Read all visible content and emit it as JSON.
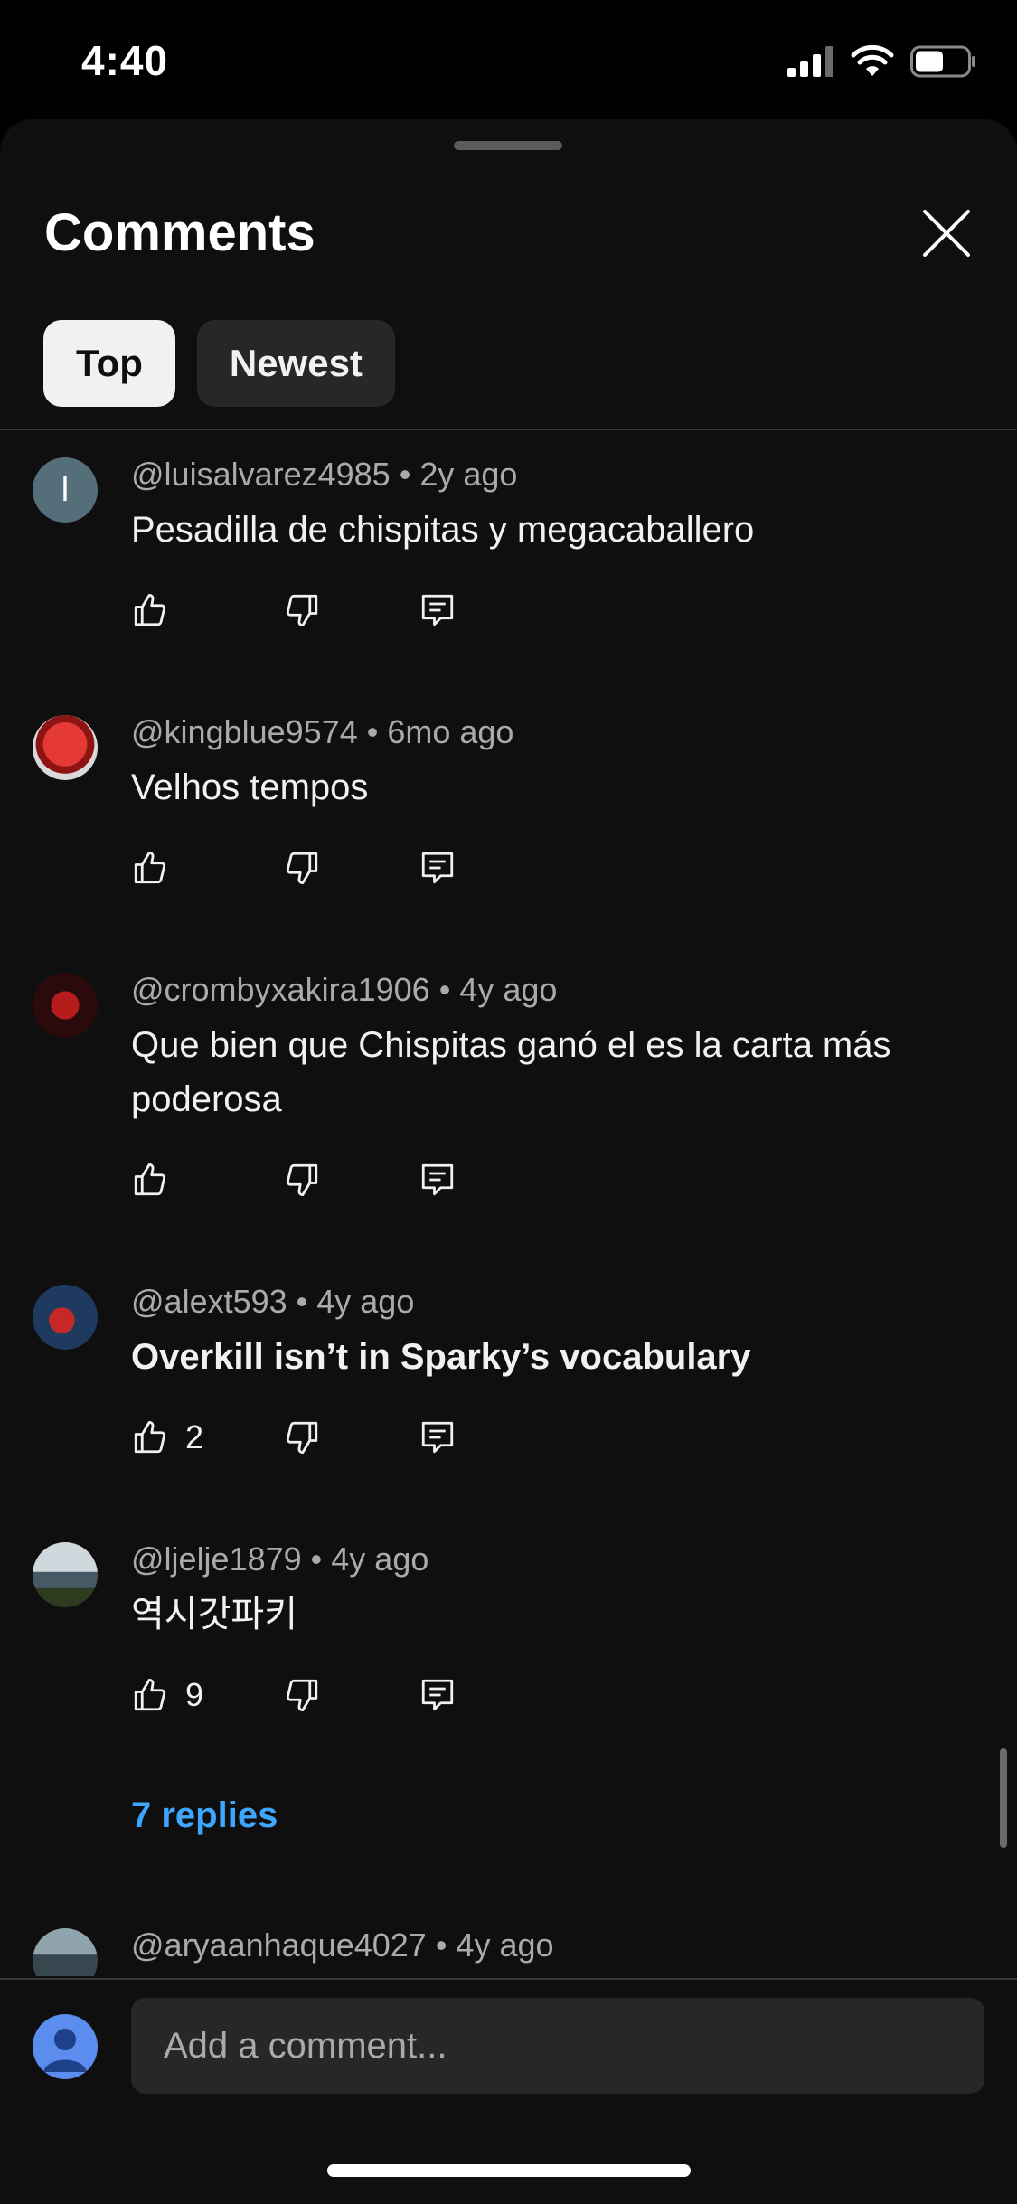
{
  "status": {
    "time": "4:40"
  },
  "sheet": {
    "title": "Comments",
    "tabs": [
      {
        "label": "Top"
      },
      {
        "label": "Newest"
      }
    ]
  },
  "comments": [
    {
      "author": "@luisalvarez4985",
      "age": "2y ago",
      "text": "Pesadilla de chispitas y megacaballero",
      "likes": "",
      "avatar_letter": "l"
    },
    {
      "author": "@kingblue9574",
      "age": "6mo ago",
      "text": "Velhos tempos",
      "likes": ""
    },
    {
      "author": "@crombyxakira1906",
      "age": "4y ago",
      "text": "Que bien que Chispitas ganó el es la carta más poderosa",
      "likes": ""
    },
    {
      "author": "@alext593",
      "age": "4y ago",
      "text": "Overkill isn’t in Sparky’s vocabulary",
      "likes": "2"
    },
    {
      "author": "@ljelje1879",
      "age": "4y ago",
      "text": "역시갓파키",
      "likes": "9",
      "replies": "7 replies"
    },
    {
      "author": "@aryaanhaque4027",
      "age": "4y ago"
    }
  ],
  "footer": {
    "placeholder": "Add a comment..."
  },
  "colors": {
    "accent": "#3ea6ff",
    "sheet_bg": "#0f0f0f",
    "chip_active": "#f1f1f1",
    "chip_inactive": "#272727"
  },
  "icons": [
    "like-icon",
    "dislike-icon",
    "reply-icon",
    "close-icon",
    "signal-icon",
    "wifi-icon",
    "battery-icon"
  ]
}
